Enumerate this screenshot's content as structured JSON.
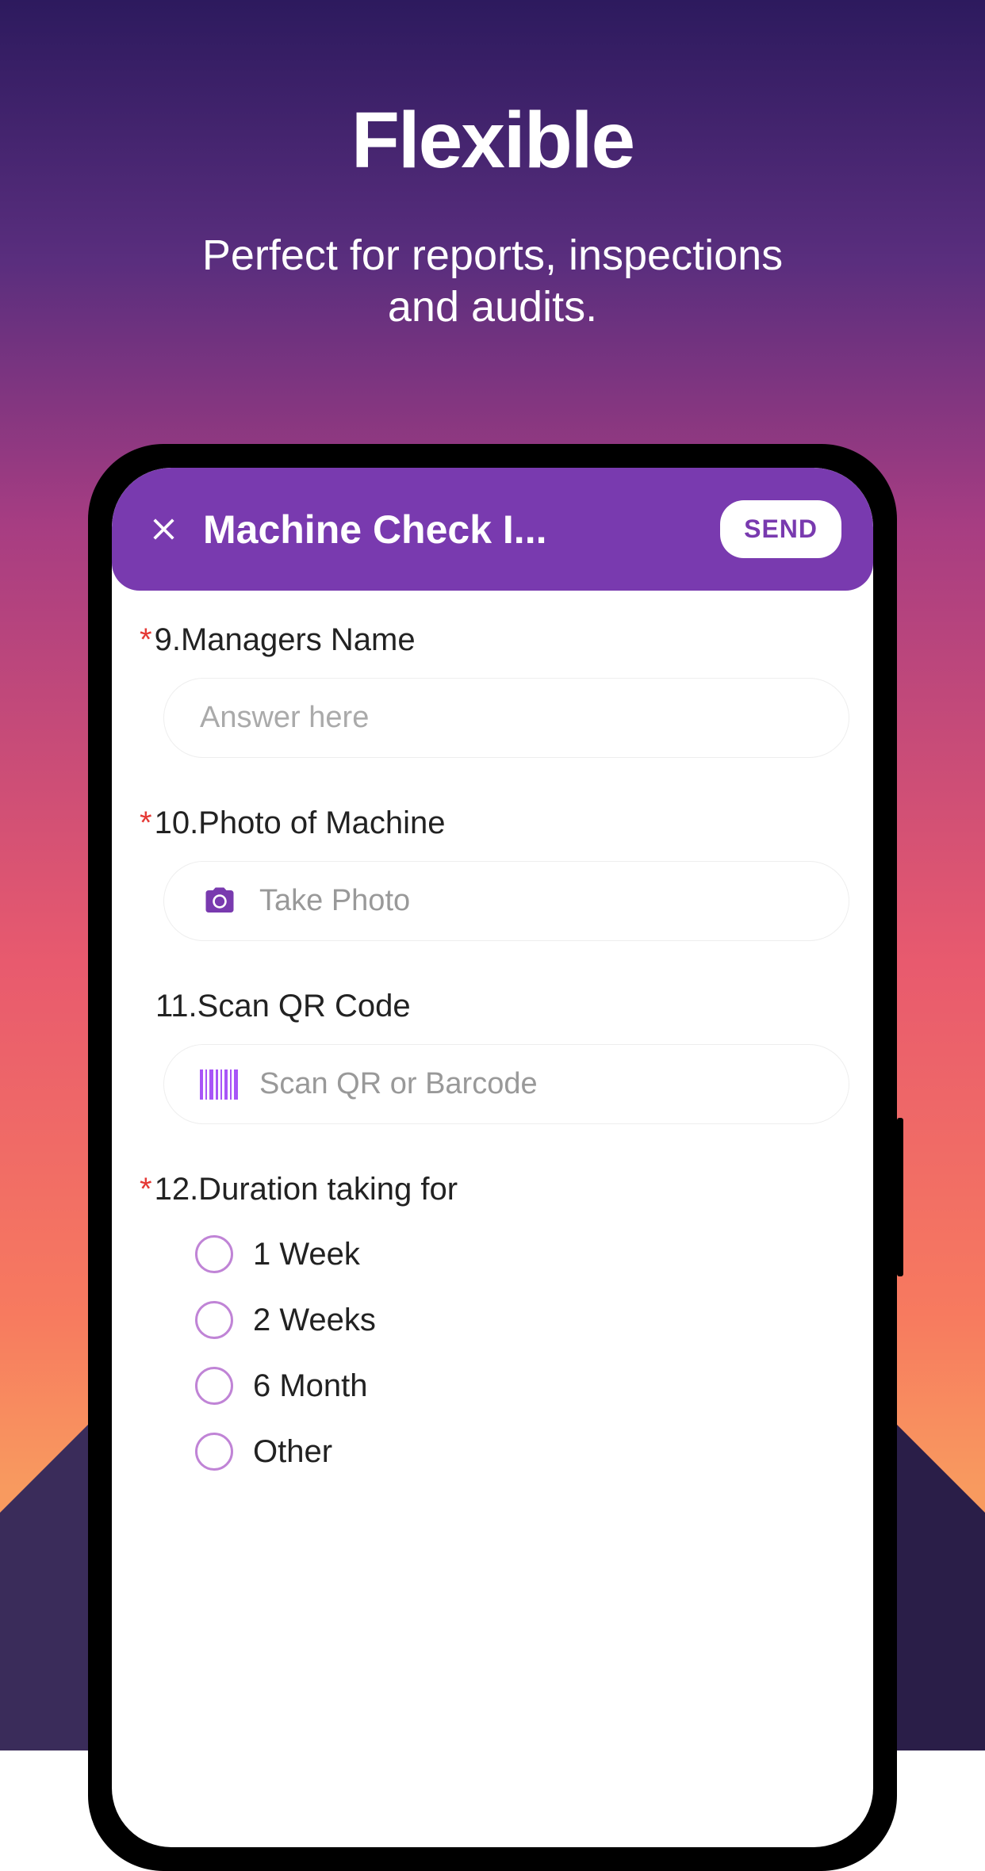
{
  "hero": {
    "title": "Flexible",
    "subtitle_line1": "Perfect for reports, inspections",
    "subtitle_line2": "and audits."
  },
  "header": {
    "title": "Machine Check I...",
    "send_label": "SEND"
  },
  "questions": {
    "q9": {
      "required": true,
      "label": "9.Managers Name",
      "placeholder": "Answer here"
    },
    "q10": {
      "required": true,
      "label": "10.Photo of Machine",
      "action_text": "Take Photo"
    },
    "q11": {
      "required": false,
      "label": "11.Scan QR Code",
      "action_text": "Scan QR or Barcode"
    },
    "q12": {
      "required": true,
      "label": "12.Duration taking for",
      "options": [
        "1 Week",
        "2 Weeks",
        "6 Month",
        "Other"
      ]
    }
  }
}
